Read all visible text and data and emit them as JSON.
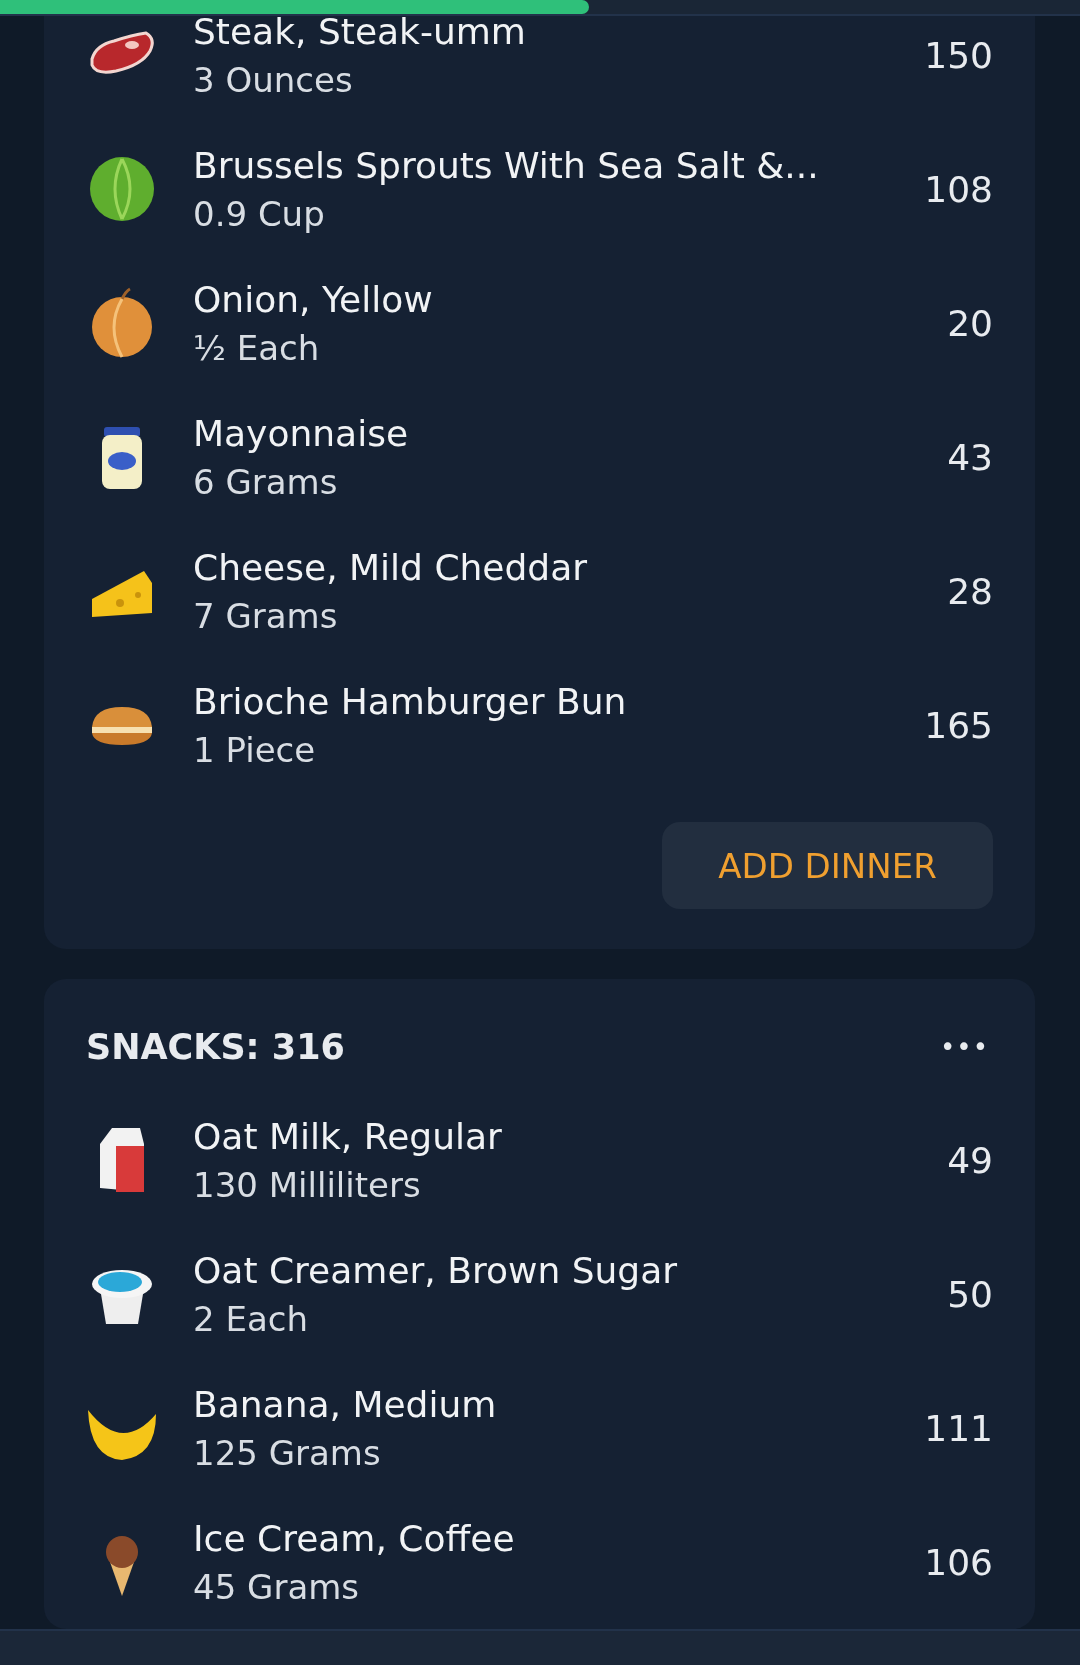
{
  "progress": {
    "level": 0.545
  },
  "meals": [
    {
      "items": [
        {
          "kind": "steak",
          "name": "Steak, Steak-umm",
          "amount": "3 Ounces",
          "calories": "150"
        },
        {
          "kind": "sprouts",
          "name": "Brussels Sprouts With Sea Salt &...",
          "amount": "0.9 Cup",
          "calories": "108"
        },
        {
          "kind": "onion",
          "name": "Onion, Yellow",
          "amount": "½ Each",
          "calories": "20"
        },
        {
          "kind": "mayo",
          "name": "Mayonnaise",
          "amount": "6 Grams",
          "calories": "43"
        },
        {
          "kind": "cheese",
          "name": "Cheese, Mild Cheddar",
          "amount": "7 Grams",
          "calories": "28"
        },
        {
          "kind": "bun",
          "name": "Brioche Hamburger Bun",
          "amount": "1 Piece",
          "calories": "165"
        }
      ],
      "add_button": "ADD DINNER"
    },
    {
      "title": "SNACKS: 316",
      "menu": "•••",
      "items": [
        {
          "kind": "milk",
          "name": "Oat Milk, Regular",
          "amount": "130 Milliliters",
          "calories": "49"
        },
        {
          "kind": "creamer",
          "name": "Oat Creamer, Brown Sugar",
          "amount": "2 Each",
          "calories": "50"
        },
        {
          "kind": "banana",
          "name": "Banana, Medium",
          "amount": "125 Grams",
          "calories": "111"
        },
        {
          "kind": "icecream",
          "name": "Ice Cream, Coffee",
          "amount": "45 Grams",
          "calories": "106"
        }
      ]
    }
  ]
}
